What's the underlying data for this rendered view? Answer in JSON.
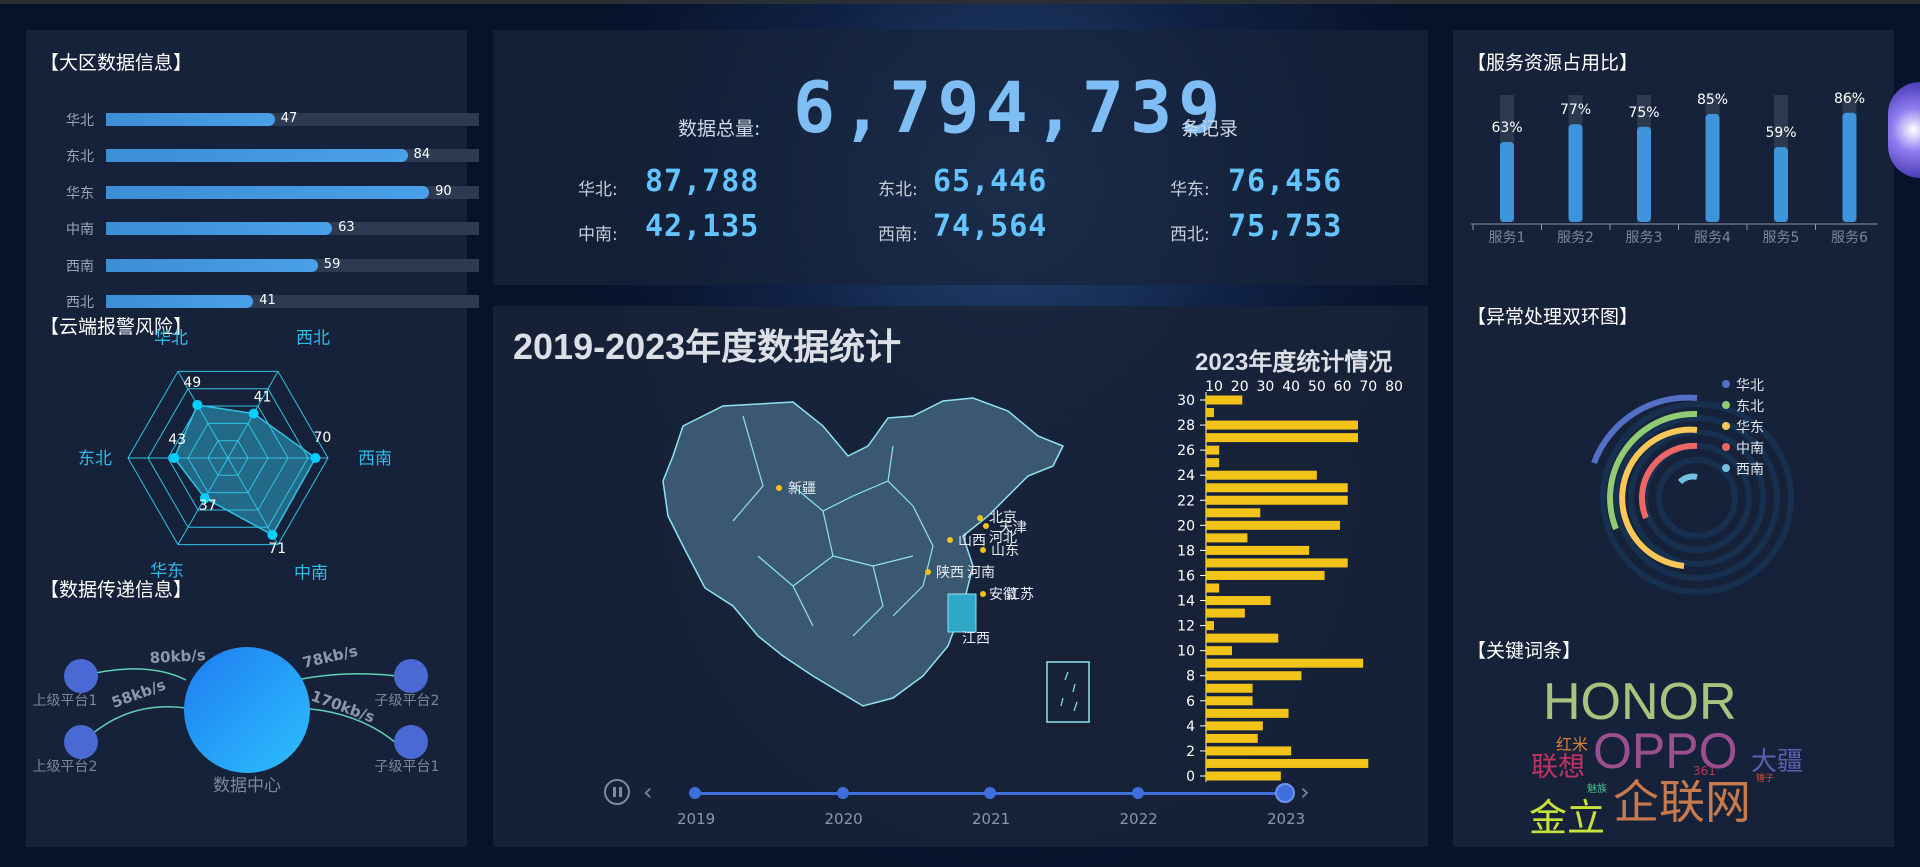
{
  "colors": {
    "accent": "#3f95dc",
    "bar_yellow": "#f2c318",
    "cyan": "#31c3e6",
    "panel": "#18243a"
  },
  "regional": {
    "title": "【大区数据信息】",
    "bars": [
      {
        "label": "华北",
        "value": 47
      },
      {
        "label": "东北",
        "value": 84
      },
      {
        "label": "华东",
        "value": 90
      },
      {
        "label": "中南",
        "value": 63
      },
      {
        "label": "西南",
        "value": 59
      },
      {
        "label": "西北",
        "value": 41
      }
    ]
  },
  "radar": {
    "title": "【云端报警风险】",
    "axes": [
      "华北",
      "西北",
      "西南",
      "中南",
      "华东",
      "东北"
    ],
    "values": [
      49,
      41,
      70,
      71,
      37,
      43
    ]
  },
  "transfer": {
    "title": "【数据传递信息】",
    "center": "数据中心",
    "nodes": [
      "上级平台1",
      "上级平台2",
      "子级平台2",
      "子级平台1"
    ],
    "rates": [
      "80kb/s",
      "58kb/s",
      "78kb/s",
      "170kb/s"
    ]
  },
  "totals": {
    "label": "数据总量:",
    "value": "6,794,739",
    "unit": "条记录",
    "regions": [
      {
        "label": "华北:",
        "value": "87,788"
      },
      {
        "label": "东北:",
        "value": "65,446"
      },
      {
        "label": "华东:",
        "value": "76,456"
      },
      {
        "label": "中南:",
        "value": "42,135"
      },
      {
        "label": "西南:",
        "value": "74,564"
      },
      {
        "label": "西北:",
        "value": "75,753"
      }
    ]
  },
  "stats": {
    "title": "2019-2023年度数据统计",
    "chart_title": "2023年度统计情况",
    "map_labels": [
      "新疆",
      "北京",
      "天津",
      "山西",
      "河北",
      "山东",
      "陕西",
      "河南",
      "安徽",
      "江苏",
      "江西"
    ],
    "timeline": {
      "years": [
        "2019",
        "2020",
        "2021",
        "2022",
        "2023"
      ],
      "current": "2023"
    }
  },
  "service": {
    "title": "【服务资源占用比】",
    "items": [
      {
        "label": "服务1",
        "value": 63,
        "text": "63%"
      },
      {
        "label": "服务2",
        "value": 77,
        "text": "77%"
      },
      {
        "label": "服务3",
        "value": 75,
        "text": "75%"
      },
      {
        "label": "服务4",
        "value": 85,
        "text": "85%"
      },
      {
        "label": "服务5",
        "value": 59,
        "text": "59%"
      },
      {
        "label": "服务6",
        "value": 86,
        "text": "86%"
      }
    ]
  },
  "rings": {
    "title": "【异常处理双环图】",
    "legend": [
      {
        "label": "华北",
        "color": "#5470c6"
      },
      {
        "label": "东北",
        "color": "#91cc75"
      },
      {
        "label": "华东",
        "color": "#fac858"
      },
      {
        "label": "中南",
        "color": "#ee6666"
      },
      {
        "label": "西南",
        "color": "#73c0de"
      }
    ]
  },
  "keywords": {
    "title": "【关键词条】",
    "words": [
      {
        "text": "HONOR",
        "color": "#a7c47e"
      },
      {
        "text": "OPPO",
        "color": "#9b4f8f"
      },
      {
        "text": "企联网",
        "color": "#c87a4c"
      },
      {
        "text": "金立",
        "color": "#c8e23c"
      },
      {
        "text": "联想",
        "color": "#c23363"
      },
      {
        "text": "大疆",
        "color": "#5b5fb0"
      },
      {
        "text": "红米",
        "color": "#d8823c"
      },
      {
        "text": "361",
        "color": "#b33a5a"
      },
      {
        "text": "魅族",
        "color": "#4cbf90"
      },
      {
        "text": "锤子",
        "color": "#d0503c"
      }
    ]
  },
  "chart_data": [
    {
      "type": "bar",
      "title": "2023年度统计情况",
      "orientation": "horizontal",
      "categories": [
        "0",
        "1",
        "2",
        "3",
        "4",
        "5",
        "6",
        "7",
        "8",
        "9",
        "10",
        "11",
        "12",
        "13",
        "14",
        "15",
        "16",
        "17",
        "18",
        "19",
        "20",
        "21",
        "22",
        "23",
        "24",
        "25",
        "26",
        "27",
        "28",
        "29",
        "30"
      ],
      "values": [
        36,
        70,
        40,
        27,
        29,
        39,
        25,
        25,
        44,
        68,
        17,
        35,
        10,
        22,
        32,
        12,
        53,
        62,
        47,
        23,
        59,
        28,
        62,
        62,
        50,
        12,
        12,
        66,
        66,
        10,
        21
      ],
      "xlim": [
        10,
        80
      ],
      "xticks": [
        "10",
        "20",
        "30",
        "40",
        "50",
        "60",
        "70",
        "80"
      ],
      "yticks": [
        "0",
        "2",
        "4",
        "6",
        "8",
        "10",
        "12",
        "14",
        "16",
        "18",
        "20",
        "22",
        "24",
        "26",
        "28",
        "30"
      ],
      "color": "#f2c318"
    },
    {
      "type": "bar",
      "title": "",
      "categories": [
        "服务1",
        "服务2",
        "服务3",
        "服务4",
        "服务5",
        "服务6"
      ],
      "values": [
        63,
        77,
        75,
        85,
        59,
        86
      ],
      "ylim": [
        0,
        100
      ]
    }
  ]
}
